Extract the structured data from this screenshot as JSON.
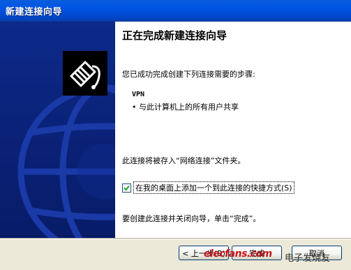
{
  "window": {
    "title": "新建连接向导"
  },
  "content": {
    "heading": "正在完成新建连接向导",
    "intro": "您已成功完成创建下列连接需要的步骤:",
    "connection_name": "VPN",
    "bullet": "• 与此计算机上的所有用户共享",
    "save_note": "此连接将被存入“网络连接”文件夹。",
    "shortcut_label": "在我的桌面上添加一个到此连接的快捷方式(S)",
    "shortcut_checked": true,
    "finish_note": "要创建此连接并关闭向导，单击“完成”。"
  },
  "buttons": {
    "back": "< 上一步(B)",
    "finish": "完成",
    "cancel": "取消"
  },
  "watermark": {
    "brand": "elecfans.com",
    "cn": "电子发烧友"
  },
  "colors": {
    "title_bar": "#0055e5",
    "side_panel": "#0a2278",
    "watermark": "#c4161c"
  },
  "icons": {
    "side": "network-plug-icon",
    "checkbox": "checkmark-icon"
  }
}
